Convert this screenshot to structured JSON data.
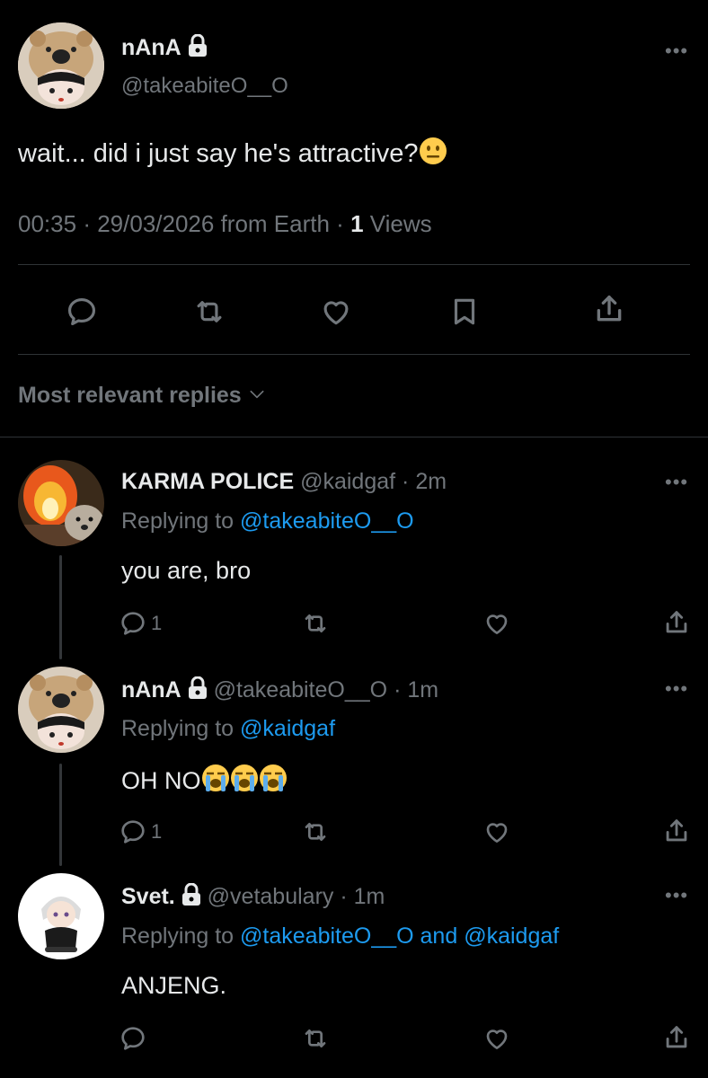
{
  "tweet": {
    "author_name": "nAnA",
    "handle": "@takeabiteO__O",
    "text": "wait... did i just say he's attractive?",
    "time": "00:35",
    "date": "29/03/2026 from Earth",
    "views_count": "1",
    "views_label": "Views"
  },
  "replies_header": "Most relevant replies",
  "replies": [
    {
      "author_name": "KARMA POLICE",
      "handle": "@kaidgaf",
      "time": "2m",
      "replying_prefix": "Replying to",
      "replying_to": "@takeabiteO__O",
      "text": "you are, bro",
      "reply_count": "1"
    },
    {
      "author_name": "nAnA",
      "handle": "@takeabiteO__O",
      "time": "1m",
      "replying_prefix": "Replying to",
      "replying_to": "@kaidgaf",
      "text": "OH NO",
      "reply_count": "1"
    },
    {
      "author_name": "Svet.",
      "handle": "@vetabulary",
      "time": "1m",
      "replying_prefix": "Replying to",
      "replying_to": "@takeabiteO__O",
      "replying_and": "and",
      "replying_to_2": "@kaidgaf",
      "text": "ANJENG."
    }
  ],
  "separator_dot": "·",
  "colors": {
    "background": "#000000",
    "text": "#e7e9ea",
    "muted": "#71767b",
    "link": "#1d9bf0",
    "divider": "#2f3336"
  }
}
